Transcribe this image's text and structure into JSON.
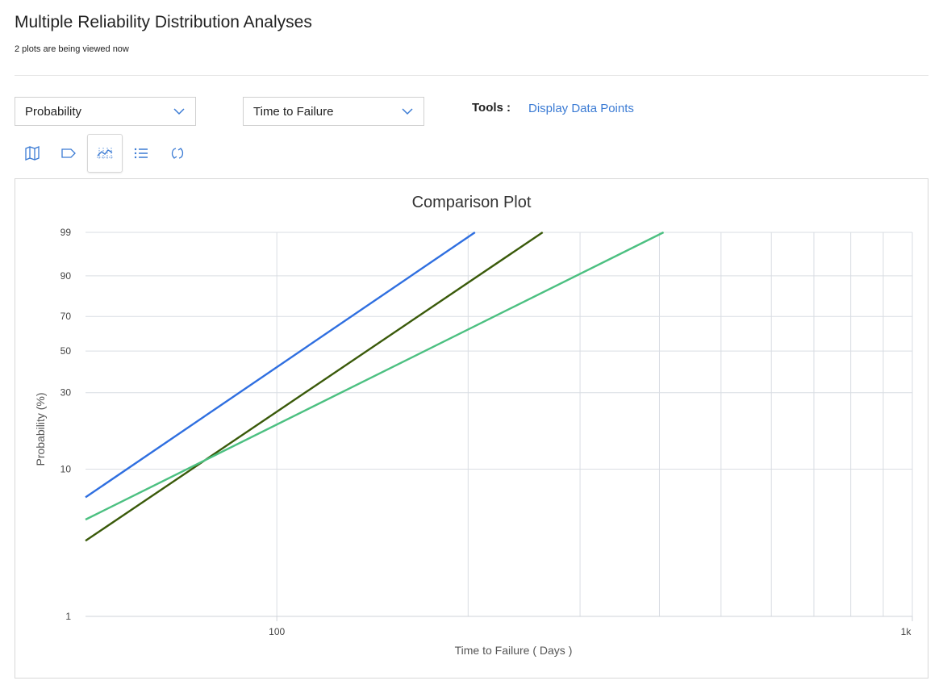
{
  "header": {
    "title": "Multiple Reliability Distribution Analyses",
    "subtitle": "2 plots are being viewed now"
  },
  "controls": {
    "plot_type": "Probability",
    "x_variable": "Time to Failure",
    "tools_label": "Tools :",
    "display_data_points": "Display Data Points"
  },
  "toolbar": {
    "icons": [
      "map-icon",
      "tag-icon",
      "chart-icon",
      "list-icon",
      "refresh-icon"
    ],
    "active_index": 2
  },
  "colors": {
    "accent": "#3b7bd4",
    "series_blue": "#2f6fe0",
    "series_dark_green": "#3a5a0a",
    "series_light_green": "#4cc081",
    "grid": "#d9dde3"
  },
  "chart_data": {
    "type": "line",
    "title": "Comparison Plot",
    "xlabel": "Time to Failure ( Days )",
    "ylabel": "Probability (%)",
    "x_scale": "log",
    "y_scale": "probability",
    "xlim": [
      50,
      1000
    ],
    "ylim": [
      1,
      99
    ],
    "x_tick_labels": [
      {
        "value": 100,
        "label": "100"
      },
      {
        "value": 1000,
        "label": "1k"
      }
    ],
    "x_minor_ticks": [
      200,
      300,
      400,
      500,
      600,
      700,
      800,
      900
    ],
    "y_ticks": [
      1,
      10,
      30,
      50,
      70,
      90,
      99
    ],
    "grid": true,
    "legend": "none",
    "series": [
      {
        "color": "#2f6fe0",
        "points": [
          [
            50,
            6.5
          ],
          [
            205,
            99
          ]
        ]
      },
      {
        "color": "#3a5a0a",
        "points": [
          [
            50,
            3.3
          ],
          [
            262,
            99
          ]
        ]
      },
      {
        "color": "#4cc081",
        "points": [
          [
            50,
            4.6
          ],
          [
            406,
            99
          ]
        ]
      }
    ]
  }
}
